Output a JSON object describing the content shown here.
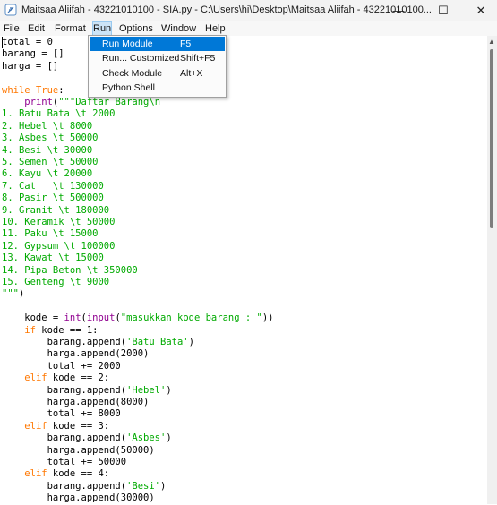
{
  "window": {
    "title": "Maitsaa Aliifah - 43221010100 - SIA.py - C:\\Users\\hi\\Desktop\\Maitsaa Aliifah - 43221010100...",
    "minimize_glyph": "—",
    "maximize_glyph": "☐",
    "close_glyph": "✕"
  },
  "menubar": [
    "File",
    "Edit",
    "Format",
    "Run",
    "Options",
    "Window",
    "Help"
  ],
  "run_menu": [
    {
      "label": "Run Module",
      "accel": "F5"
    },
    {
      "label": "Run... Customized",
      "accel": "Shift+F5"
    },
    {
      "label": "Check Module",
      "accel": "Alt+X"
    },
    {
      "label": "Python Shell",
      "accel": ""
    }
  ],
  "code_lines": [
    [
      [
        "",
        "total = 0"
      ]
    ],
    [
      [
        "",
        "barang = []"
      ]
    ],
    [
      [
        "",
        "harga = []"
      ]
    ],
    [
      [
        "",
        ""
      ]
    ],
    [
      [
        "kw",
        "while"
      ],
      [
        "",
        " "
      ],
      [
        "kw",
        "True"
      ],
      [
        "",
        ":"
      ]
    ],
    [
      [
        "",
        "    "
      ],
      [
        "bi",
        "print"
      ],
      [
        "",
        "("
      ],
      [
        "st",
        "\"\"\"Daftar Barang\\n"
      ]
    ],
    [
      [
        "st",
        "1. Batu Bata \\t 2000"
      ]
    ],
    [
      [
        "st",
        "2. Hebel \\t 8000"
      ]
    ],
    [
      [
        "st",
        "3. Asbes \\t 50000"
      ]
    ],
    [
      [
        "st",
        "4. Besi \\t 30000"
      ]
    ],
    [
      [
        "st",
        "5. Semen \\t 50000"
      ]
    ],
    [
      [
        "st",
        "6. Kayu \\t 20000"
      ]
    ],
    [
      [
        "st",
        "7. Cat   \\t 130000"
      ]
    ],
    [
      [
        "st",
        "8. Pasir \\t 500000"
      ]
    ],
    [
      [
        "st",
        "9. Granit \\t 180000"
      ]
    ],
    [
      [
        "st",
        "10. Keramik \\t 50000"
      ]
    ],
    [
      [
        "st",
        "11. Paku \\t 15000"
      ]
    ],
    [
      [
        "st",
        "12. Gypsum \\t 100000"
      ]
    ],
    [
      [
        "st",
        "13. Kawat \\t 15000"
      ]
    ],
    [
      [
        "st",
        "14. Pipa Beton \\t 350000"
      ]
    ],
    [
      [
        "st",
        "15. Genteng \\t 9000"
      ]
    ],
    [
      [
        "st",
        "\"\"\""
      ],
      [
        "",
        ")"
      ]
    ],
    [
      [
        "",
        ""
      ]
    ],
    [
      [
        "",
        "    kode = "
      ],
      [
        "bi",
        "int"
      ],
      [
        "",
        "("
      ],
      [
        "bi",
        "input"
      ],
      [
        "",
        "("
      ],
      [
        "st",
        "\"masukkan kode barang : \""
      ],
      [
        "",
        "))"
      ]
    ],
    [
      [
        "",
        "    "
      ],
      [
        "kw",
        "if"
      ],
      [
        "",
        " kode == 1:"
      ]
    ],
    [
      [
        "",
        "        barang.append("
      ],
      [
        "st",
        "'Batu Bata'"
      ],
      [
        "",
        ")"
      ]
    ],
    [
      [
        "",
        "        harga.append(2000)"
      ]
    ],
    [
      [
        "",
        "        total += 2000"
      ]
    ],
    [
      [
        "",
        "    "
      ],
      [
        "kw",
        "elif"
      ],
      [
        "",
        " kode == 2:"
      ]
    ],
    [
      [
        "",
        "        barang.append("
      ],
      [
        "st",
        "'Hebel'"
      ],
      [
        "",
        ")"
      ]
    ],
    [
      [
        "",
        "        harga.append(8000)"
      ]
    ],
    [
      [
        "",
        "        total += 8000"
      ]
    ],
    [
      [
        "",
        "    "
      ],
      [
        "kw",
        "elif"
      ],
      [
        "",
        " kode == 3:"
      ]
    ],
    [
      [
        "",
        "        barang.append("
      ],
      [
        "st",
        "'Asbes'"
      ],
      [
        "",
        ")"
      ]
    ],
    [
      [
        "",
        "        harga.append(50000)"
      ]
    ],
    [
      [
        "",
        "        total += 50000"
      ]
    ],
    [
      [
        "",
        "    "
      ],
      [
        "kw",
        "elif"
      ],
      [
        "",
        " kode == 4:"
      ]
    ],
    [
      [
        "",
        "        barang.append("
      ],
      [
        "st",
        "'Besi'"
      ],
      [
        "",
        ")"
      ]
    ],
    [
      [
        "",
        "        harga.append(30000)"
      ]
    ]
  ]
}
